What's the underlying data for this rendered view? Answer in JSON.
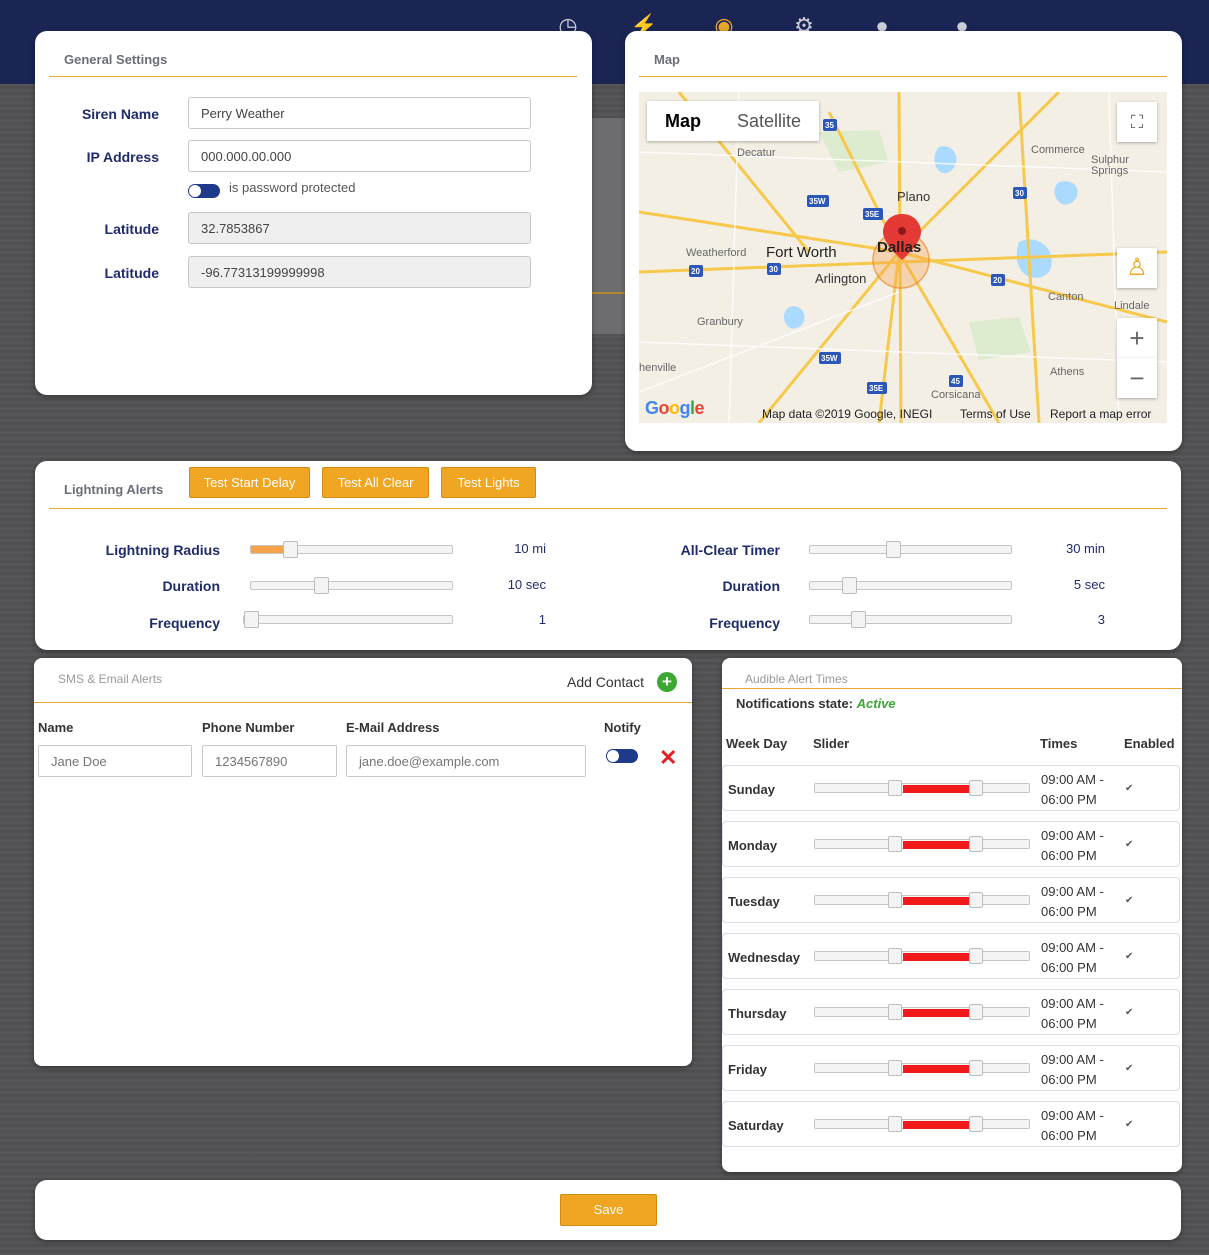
{
  "colors": {
    "accent": "#f0a623",
    "navy": "#1f2b6c",
    "rule": "#e6a52c",
    "range_red": "#f21a1a",
    "active_green": "#3aa832"
  },
  "general": {
    "title": "General Settings",
    "siren_label": "Siren Name",
    "siren_value": "Perry Weather",
    "ip_label": "IP Address",
    "ip_value": "000.000.00.000",
    "password_toggle_label": "is password protected",
    "latitude_label": "Latitude",
    "latitude_value": "32.7853867",
    "longitude_label": "Latitude",
    "longitude_value": "-96.77313199999998"
  },
  "map": {
    "title": "Map",
    "tab_map": "Map",
    "tab_satellite": "Satellite",
    "labels": [
      "Decatur",
      "Commerce",
      "Sulphur Springs",
      "Plano",
      "Weatherford",
      "Fort Worth",
      "Dallas",
      "Arlington",
      "Granbury",
      "Canton",
      "Lindale",
      "Athens",
      "Corsicana",
      "henville"
    ],
    "attribution": "Map data ©2019 Google, INEGI",
    "terms": "Terms of Use",
    "report": "Report a map error",
    "logo": "Google"
  },
  "lightning": {
    "title": "Lightning Alerts",
    "buttons": [
      "Test Start Delay",
      "Test All Clear",
      "Test Lights"
    ],
    "left": [
      {
        "label": "Lightning Radius",
        "value": "10 mi",
        "level": 0.17
      },
      {
        "label": "Duration",
        "value": "10 sec",
        "level": 0.34
      },
      {
        "label": "Frequency",
        "value": "1",
        "level": 0.0
      }
    ],
    "right": [
      {
        "label": "All-Clear Timer",
        "value": "30 min",
        "level": 0.41
      },
      {
        "label": "Duration",
        "value": "5 sec",
        "level": 0.17
      },
      {
        "label": "Frequency",
        "value": "3",
        "level": 0.22
      }
    ]
  },
  "sms": {
    "title": "SMS & Email Alerts",
    "add_contact": "Add Contact",
    "headers": {
      "name": "Name",
      "phone": "Phone Number",
      "email": "E-Mail Address",
      "notify": "Notify"
    },
    "contact": {
      "name_placeholder": "Jane Doe",
      "phone_placeholder": "1234567890",
      "email_placeholder": "jane.doe@example.com"
    }
  },
  "audible": {
    "title": "Audible Alert Times",
    "state_label": "Notifications state:",
    "state_value": "Active",
    "headers": {
      "day": "Week Day",
      "slider": "Slider",
      "times": "Times",
      "enabled": "Enabled"
    },
    "days": [
      {
        "day": "Sunday",
        "start": "09:00 AM -",
        "end": "06:00 PM",
        "enabled": true
      },
      {
        "day": "Monday",
        "start": "09:00 AM -",
        "end": "06:00 PM",
        "enabled": true
      },
      {
        "day": "Tuesday",
        "start": "09:00 AM -",
        "end": "06:00 PM",
        "enabled": true
      },
      {
        "day": "Wednesday",
        "start": "09:00 AM -",
        "end": "06:00 PM",
        "enabled": true
      },
      {
        "day": "Thursday",
        "start": "09:00 AM -",
        "end": "06:00 PM",
        "enabled": true
      },
      {
        "day": "Friday",
        "start": "09:00 AM -",
        "end": "06:00 PM",
        "enabled": true
      },
      {
        "day": "Saturday",
        "start": "09:00 AM -",
        "end": "06:00 PM",
        "enabled": true
      }
    ]
  },
  "save_label": "Save"
}
